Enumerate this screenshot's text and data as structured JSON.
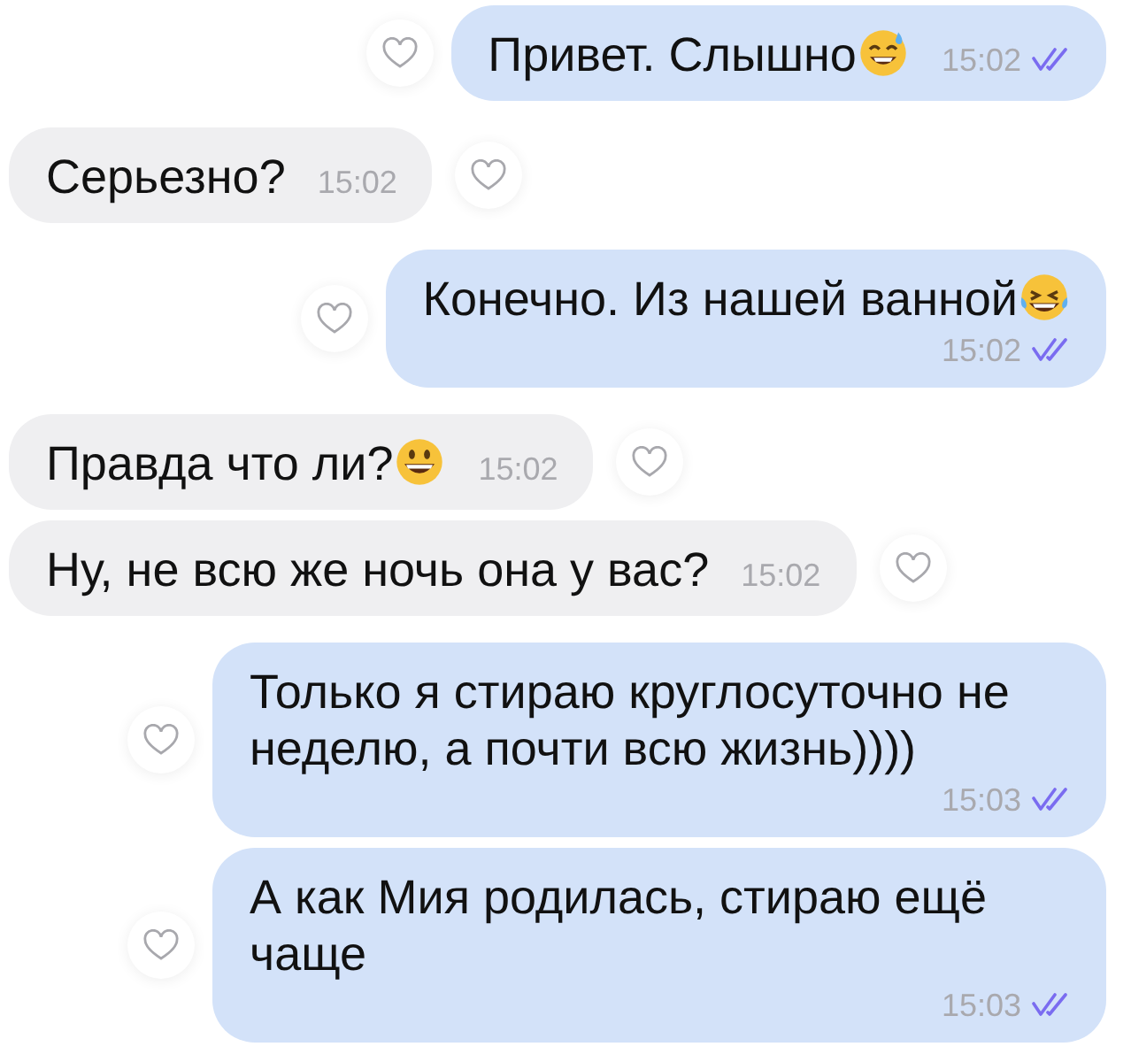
{
  "messages": [
    {
      "outgoing": true,
      "kind": "sweat",
      "text": "Привет. Слышно",
      "time": "15:02",
      "time_below": false,
      "read": true,
      "liked": false
    },
    {
      "outgoing": false,
      "kind": "plain",
      "text": "Серьезно?",
      "time": "15:02",
      "time_below": false,
      "liked": false
    },
    {
      "outgoing": true,
      "kind": "tears",
      "text": "Конечно. Из нашей ванной",
      "time": "15:02",
      "time_below": true,
      "read": true,
      "liked": false
    },
    {
      "outgoing": false,
      "kind": "grin",
      "text": "Правда что ли?",
      "time": "15:02",
      "time_below": false,
      "liked": false
    },
    {
      "outgoing": false,
      "kind": "plain",
      "text": "Ну, не всю же ночь она у вас?",
      "time": "15:02",
      "time_below": false,
      "liked": false
    },
    {
      "outgoing": true,
      "kind": "plain",
      "text": "Только я стираю круглосуточно не неделю, а почти всю жизнь))))",
      "time": "15:03",
      "time_below": true,
      "read": true,
      "liked": false
    },
    {
      "outgoing": true,
      "kind": "plain",
      "text": "А как Мия родилась, стираю ещё чаще",
      "time": "15:03",
      "time_below": true,
      "read": true,
      "liked": false
    }
  ]
}
